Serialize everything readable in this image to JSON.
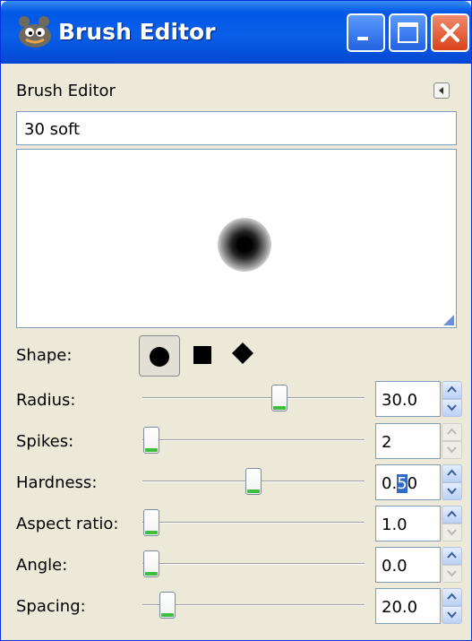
{
  "window": {
    "title": "Brush Editor",
    "app_icon": "gimp-wilber-icon"
  },
  "title_buttons": {
    "minimize": "minimize-icon",
    "maximize": "maximize-icon",
    "close": "close-icon"
  },
  "editor": {
    "header": "Brush Editor",
    "brush_name": "30 soft",
    "shape_label": "Shape:",
    "shapes": [
      {
        "name": "circle",
        "glyph": "●",
        "active": true
      },
      {
        "name": "square",
        "glyph": "■",
        "active": false
      },
      {
        "name": "diamond",
        "glyph": "◆",
        "active": false
      }
    ],
    "params": [
      {
        "key": "radius",
        "label": "Radius:",
        "value": "30.0",
        "slider_fraction": 0.62
      },
      {
        "key": "spikes",
        "label": "Spikes:",
        "value": "2",
        "slider_fraction": 0.0
      },
      {
        "key": "hardness",
        "label": "Hardness:",
        "value_pre": "0.",
        "value_sel": "5",
        "value_post": "0",
        "slider_fraction": 0.5
      },
      {
        "key": "aspect_ratio",
        "label": "Aspect ratio:",
        "value": "1.0",
        "slider_fraction": 0.0
      },
      {
        "key": "angle",
        "label": "Angle:",
        "value": "0.0",
        "slider_fraction": 0.0
      },
      {
        "key": "spacing",
        "label": "Spacing:",
        "value": "20.0",
        "slider_fraction": 0.1
      }
    ]
  },
  "colors": {
    "titlebar": "#0058E6",
    "close": "#D9421B",
    "window_bg": "#ECE9D8",
    "thumb_accent": "#3FBF3F",
    "selection": "#316AC5"
  }
}
